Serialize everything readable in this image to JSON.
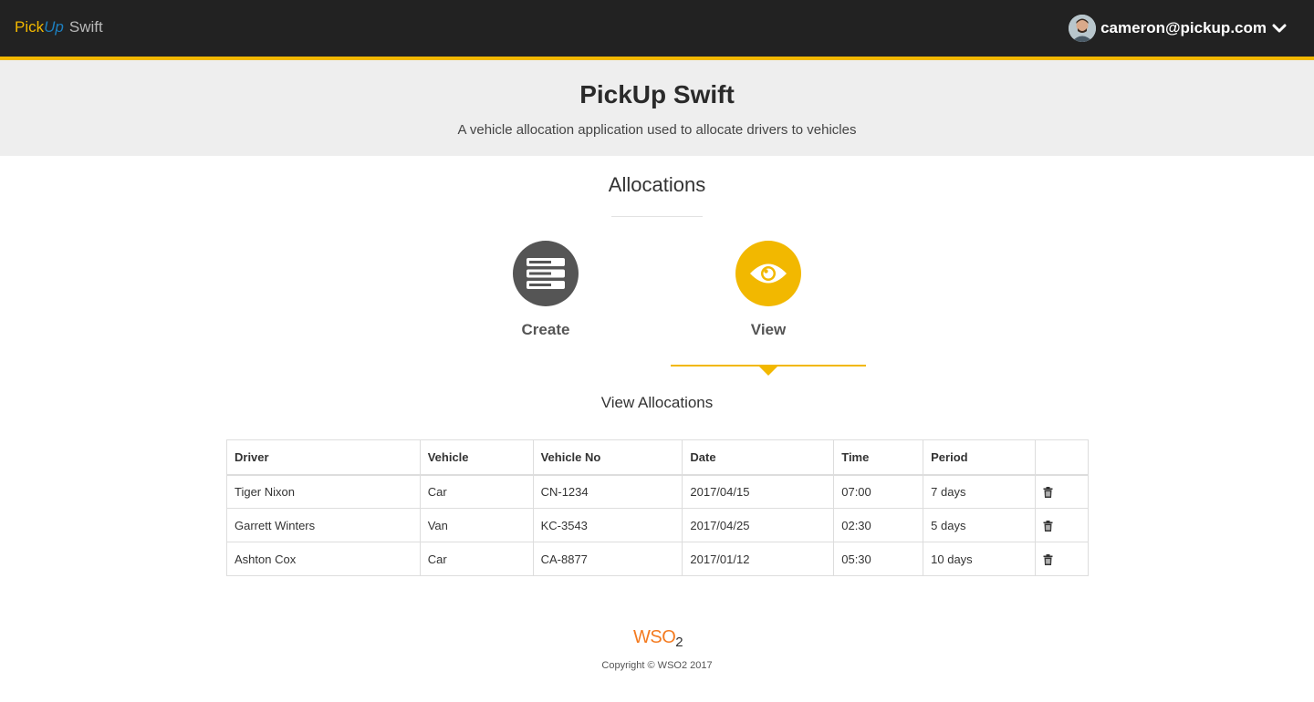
{
  "nav": {
    "brand_pick": "Pick",
    "brand_up": "Up",
    "brand_swift": "Swift",
    "user_email": "cameron@pickup.com"
  },
  "hero": {
    "title": "PickUp Swift",
    "subtitle": "A vehicle allocation application used to allocate drivers to vehicles"
  },
  "section": {
    "title": "Allocations",
    "actions": [
      {
        "label": "Create",
        "icon": "server-list-icon",
        "color": "#555555"
      },
      {
        "label": "View",
        "icon": "eye-icon",
        "color": "#f2b800",
        "active": true
      }
    ]
  },
  "view": {
    "title": "View Allocations",
    "columns": [
      "Driver",
      "Vehicle",
      "Vehicle No",
      "Date",
      "Time",
      "Period",
      ""
    ],
    "rows": [
      {
        "driver": "Tiger Nixon",
        "vehicle": "Car",
        "vehicle_no": "CN-1234",
        "date": "2017/04/15",
        "time": "07:00",
        "period": "7 days"
      },
      {
        "driver": "Garrett Winters",
        "vehicle": "Van",
        "vehicle_no": "KC-3543",
        "date": "2017/04/25",
        "time": "02:30",
        "period": "5 days"
      },
      {
        "driver": "Ashton Cox",
        "vehicle": "Car",
        "vehicle_no": "CA-8877",
        "date": "2017/01/12",
        "time": "05:30",
        "period": "10 days"
      }
    ]
  },
  "footer": {
    "logo_text": "WSO",
    "logo_sub": "2",
    "copyright": "Copyright © WSO2 2017"
  },
  "colors": {
    "accent": "#f2b800",
    "topbar": "#222222",
    "hero_bg": "#eeeeee"
  }
}
